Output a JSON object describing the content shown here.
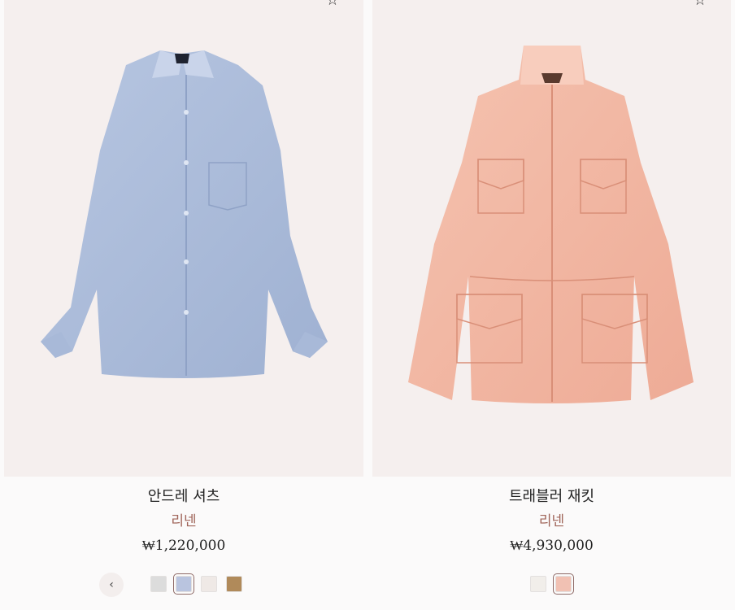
{
  "products": [
    {
      "name": "안드레 셔츠",
      "material": "리넨",
      "price": "₩1,220,000",
      "swatches": [
        {
          "color": "#dcdcdc",
          "selected": false
        },
        {
          "color": "#b9c4df",
          "selected": true
        },
        {
          "color": "#efe9e6",
          "selected": false
        },
        {
          "color": "#b08a5a",
          "selected": false
        }
      ]
    },
    {
      "name": "트래블러 재킷",
      "material": "리넨",
      "price": "₩4,930,000",
      "swatches": [
        {
          "color": "#f1eeea",
          "selected": false
        },
        {
          "color": "#f1c1b3",
          "selected": true
        }
      ]
    }
  ],
  "icons": {
    "prev": "chevron-left-icon",
    "wishlist": "star-icon"
  },
  "ui": {
    "prev_glyph": "‹",
    "wish_glyph": "☆"
  },
  "colors": {
    "shirt": "#a9bad8",
    "jacket": "#f2b7a2",
    "material_text": "#a0655a"
  }
}
